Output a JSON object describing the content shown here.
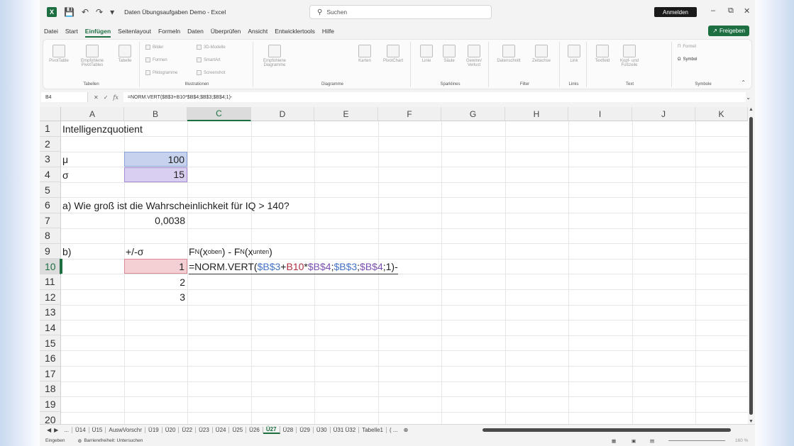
{
  "titlebar": {
    "title": "Daten Übungsaufgaben Demo  -  Excel",
    "search_placeholder": "Suchen",
    "signin": "Anmelden"
  },
  "menu": [
    "Datei",
    "Start",
    "Einfügen",
    "Seitenlayout",
    "Formeln",
    "Daten",
    "Überprüfen",
    "Ansicht",
    "Entwicklertools",
    "Hilfe"
  ],
  "menu_active": "Einfügen",
  "share_label": "Freigeben",
  "ribbon": {
    "groups": [
      "Tabellen",
      "Illustrationen",
      "Diagramme",
      "Sparklines",
      "Filter",
      "Links",
      "Text",
      "Symbole"
    ],
    "tabellen": [
      "PivotTable",
      "Empfohlene PivotTables",
      "Tabelle"
    ],
    "illustrationen": [
      "Bilder",
      "Formen",
      "Piktogramme",
      "3D-Modelle",
      "SmartArt",
      "Screenshot"
    ],
    "diagramme": [
      "Empfohlene Diagramme",
      "Karten",
      "PivotChart"
    ],
    "sparklines": [
      "Linie",
      "Säule",
      "Gewinn/ Verlust"
    ],
    "filter": [
      "Datenschnitt",
      "Zeitachse"
    ],
    "links": [
      "Link"
    ],
    "text": [
      "Textfeld",
      "Kopf- und Fußzeile"
    ],
    "symbole": [
      "Formel",
      "Symbol"
    ]
  },
  "formula_bar": {
    "namebox": "B4",
    "formula": "=NORM.VERT($B$3+B10*$B$4;$B$3;$B$4;1)-"
  },
  "columns": [
    "A",
    "B",
    "C",
    "D",
    "E",
    "F",
    "G",
    "H",
    "I",
    "J",
    "K"
  ],
  "rows": [
    "1",
    "2",
    "3",
    "4",
    "5",
    "6",
    "7",
    "8",
    "9",
    "10",
    "11",
    "12",
    "13",
    "14",
    "15",
    "16",
    "17",
    "18",
    "19",
    "20"
  ],
  "cells": {
    "A1": "Intelligenzquotient",
    "A3": "μ",
    "B3": "100",
    "A4": "σ",
    "B4": "15",
    "A6": "a) Wie groß ist die Wahrscheinlichkeit für IQ > 140?",
    "B7": "0,0038",
    "A9": "b)",
    "B9": "+/-σ",
    "C9_fn1": "F",
    "C9_sub1": "N",
    "C9_mid1": "(x",
    "C9_sub2": "oben",
    "C9_mid2": ") - F",
    "C9_sub3": "N",
    "C9_mid3": "(x",
    "C9_sub4": "unten",
    "C9_end": ")",
    "B10": "1",
    "B11": "2",
    "B12": "3",
    "C10_parts": {
      "p1": "=NORM.VERT(",
      "p2": "$B$3",
      "p3": "+",
      "p4": "B10",
      "p5": "*",
      "p6": "$B$4",
      "p7": ";",
      "p8": "$B$3",
      "p9": ";",
      "p10": "$B$4",
      "p11": ";1)-"
    }
  },
  "sheet_tabs": [
    "...",
    "Ü14",
    "Ü15",
    "AuswVorschr",
    "Ü19",
    "Ü20",
    "Ü22",
    "Ü23",
    "Ü24",
    "Ü25",
    "Ü26",
    "Ü27",
    "Ü28",
    "Ü29",
    "Ü30",
    "Ü31 Ü32",
    "Tabelle1",
    "( ..."
  ],
  "active_sheet": "Ü27",
  "status": {
    "mode": "Eingeben",
    "accessibility": "Barrierefreiheit: Untersuchen",
    "zoom": "160 %"
  }
}
